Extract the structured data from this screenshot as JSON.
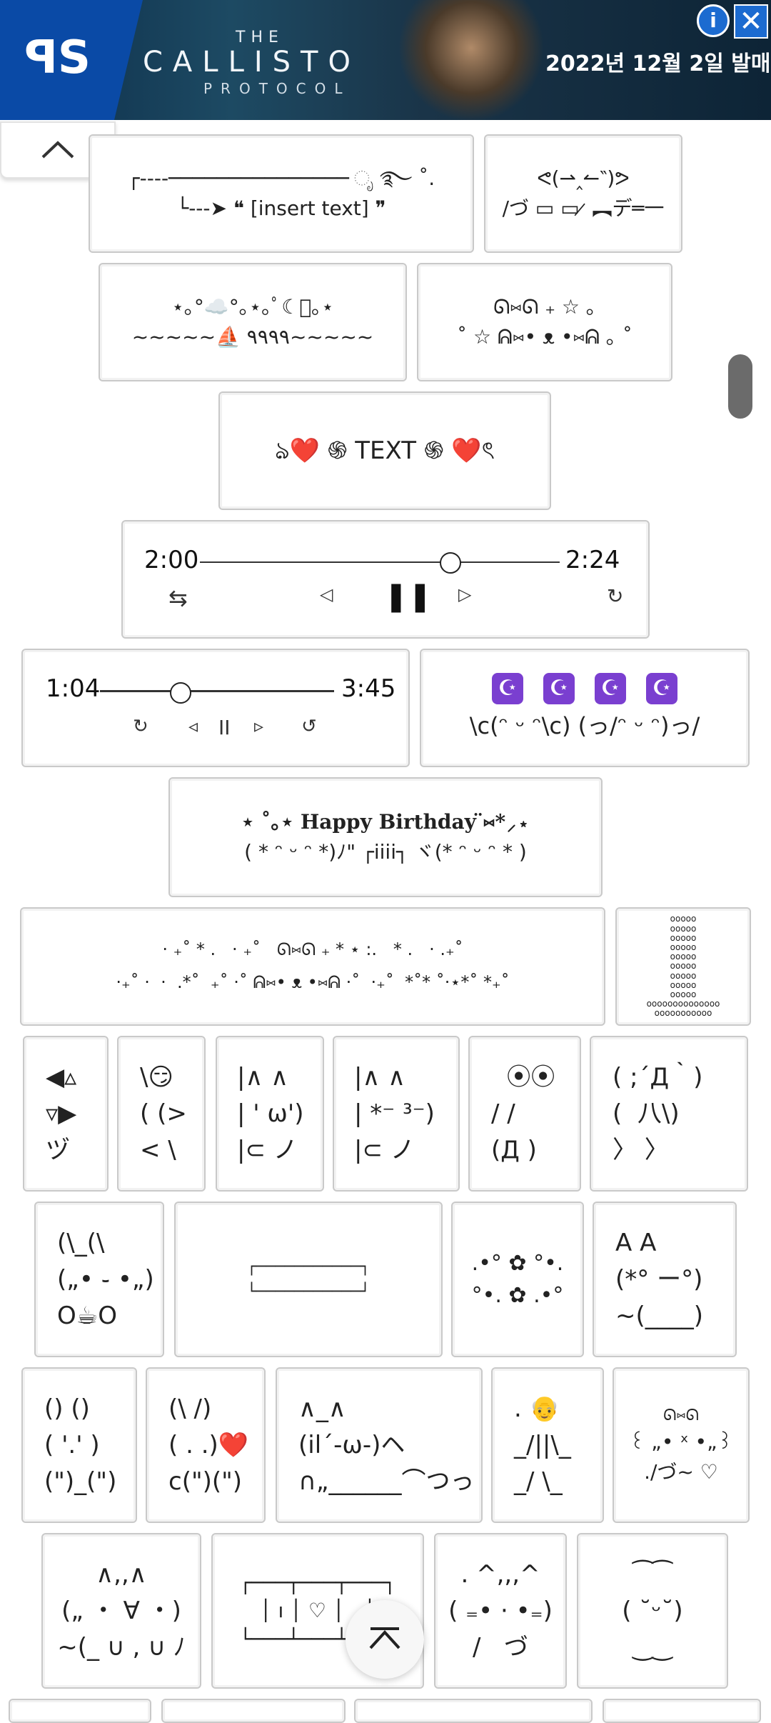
{
  "ad": {
    "the": "THE",
    "title": "CALLISTO",
    "subtitle": "PROTOCOL",
    "date_text": "2022년 12월 2일 발매",
    "ps_logo": "playstation-logo",
    "info_icon": "info-icon",
    "close_icon": "close-icon"
  },
  "controls": {
    "collapse_icon": "chevron-up-icon",
    "scroll_icon": "scroll-handle",
    "back_to_top_icon": "chevron-up-icon"
  },
  "cards": {
    "c1": [
      "┌----─────────────── ೃ ࿐ ˚.",
      "└---➤ ❝ [insert text] ❞"
    ],
    "c2": [
      "ᕙ(⇀‸↼‶)ᕗ",
      "/づ ▭ ▭ ̷ ︻デ═一"
    ],
    "c3": [
      "⋆｡°☁️°｡⋆｡ﾟ☾ﾟ｡⋆",
      "~~~~~⛵ ٩٩٩٩~~~~~"
    ],
    "c4": [
      "ᘏ⑅ᘏ ₊ ☆ ｡",
      "˚ ☆ ᕱ⑅• ᴥ •⑅ᕱ ｡ ˚"
    ],
    "c5": [
      "ঌ❤️ ֍ TEXT ֍ ❤️ৎ"
    ],
    "c7": [
      "\\c(ᵔ ᵕ ᵔ\\c) (っ/ᵔ ᵕ ᵔ)っ/"
    ],
    "c8": [
      "⋆ ˚｡⋆ Happy Birthday ̈⑅*⸝⋆",
      "( * ᵔ ᵕ ᵔ *)ﾉ\" ┌iiii┐ ヾ(* ᵔ ᵕ ᵔ * )"
    ],
    "c9": [
      "· ₊˚ * .   · ₊˚   ᘏ⑅ᘏ ₊ * ⋆ :.   * .   · .₊˚",
      "·₊˚ ·  ·  .*˚  ₊˚ ·˚ ᕱ⑅• ᴥ •⑅ᕱ ·˚  ·₊˚  *˚* ˚·⋆*˚ *₊˚"
    ],
    "c10": [
      "ooooo",
      "ooooo",
      "ooooo",
      "ooooo",
      "ooooo",
      "ooooo",
      "ooooo",
      "ooooo",
      "ooooo",
      "oooooooooooooo",
      "ooooooooooo"
    ],
    "c11": [
      "◀▵",
      "▿▶",
      "ヅ"
    ],
    "c12": [
      "\\😏",
      "( (>",
      "< \\"
    ],
    "c13": [
      "|∧ ∧",
      "| ' ω')",
      "|⊂ ノ"
    ],
    "c14": [
      "|∧ ∧",
      "| *⁻ ³⁻)",
      "|⊂ ノ"
    ],
    "c15": [
      "  ⦿⦿",
      "/ /",
      "(Д )"
    ],
    "c16": [
      "( ;´Д｀)",
      "(  八\\)",
      "〉 〉"
    ],
    "c17": [
      "(\\_(\\",
      "(„• ֊ •„)",
      "O☕O"
    ],
    "c18": [
      "┌───────────┐",
      "",
      "",
      "└───────────┘"
    ],
    "c19": [
      ".•° ✿ °•.",
      "",
      "°•. ✿ .•°"
    ],
    "c20": [
      "A A",
      "(*° ー°)",
      "~(____)"
    ],
    "c21": [
      "() ()",
      "( '.' )",
      "(\")_(\")"
    ],
    "c22": [
      "(\\ /)",
      "( . .)❤️",
      "c(\")(\")"
    ],
    "c23": [
      "∧_∧",
      "(il´-ω-)ヘ",
      "∩„______⌒つっ"
    ],
    "c24": [
      ". 👴",
      "_/||\\_",
      "_/ \\_"
    ],
    "c25": [
      "ᘏ⑅ᘏ",
      "꒰ „• ˣ •„꒱",
      "./づ~ ♡"
    ],
    "c26": [
      "∧,,∧",
      "(„ ・ ∀ ・)",
      "~(_ ∪ , ∪ ﾉ"
    ],
    "c27": [
      "┌───┬───┬───┐",
      "│ ı │ ♡ │   │",
      "└───┴───┴───┘"
    ],
    "c28": [
      ". ^,,,^",
      "( ₌• · •₌)",
      "/   づ"
    ],
    "c29": [
      "⁀⁀",
      "( ˘ᵕ˘)",
      "‿‿"
    ]
  },
  "players": {
    "p1": {
      "current": "2:00",
      "total": "2:24",
      "progress": 0.79,
      "shuffle": "⇆",
      "prev": "◁",
      "play": "❚❚",
      "next": "▷",
      "repeat": "↻"
    },
    "p2": {
      "current": "1:04",
      "total": "3:45",
      "progress": 0.28,
      "repeat": "↻",
      "prev": "◃",
      "play": "II",
      "next": "▹",
      "loop": "↺"
    }
  },
  "moon_icons": [
    "☪",
    "☪",
    "☪",
    "☪"
  ]
}
